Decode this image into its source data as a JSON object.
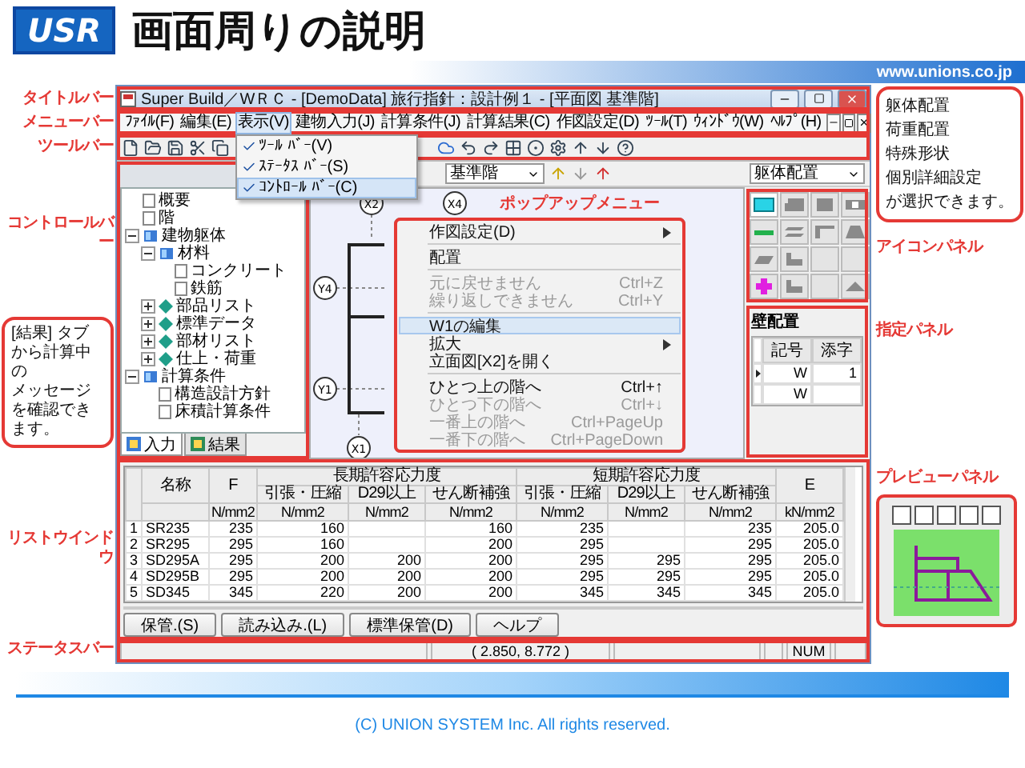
{
  "header": {
    "logo": "USR",
    "title": "画面周りの説明",
    "url": "www.unions.co.jp"
  },
  "left_labels": [
    "タイトルバー",
    "メニューバー",
    "ツールバー",
    "コントロールバー",
    "リストウインドウ",
    "ステータスバー"
  ],
  "left_callout": [
    "[結果] タブから計算中の",
    "メッセージを確認できます。"
  ],
  "window": {
    "title": "Super Build／WＲＣ - [DemoData] 旅行指針：設計例１ - [平面図 基準階]"
  },
  "menus": [
    {
      "label": "ﾌｧｲﾙ(F)",
      "selected": false
    },
    {
      "label": "編集(E)",
      "selected": false
    },
    {
      "label": "表示(V)",
      "selected": true
    },
    {
      "label": "建物入力(J)",
      "selected": false
    },
    {
      "label": "計算条件(J)",
      "selected": false
    },
    {
      "label": "計算結果(C)",
      "selected": false
    },
    {
      "label": "作図設定(D)",
      "selected": false
    },
    {
      "label": "ﾂｰﾙ(T)",
      "selected": false
    },
    {
      "label": "ｳｨﾝﾄﾞｳ(W)",
      "selected": false
    },
    {
      "label": "ﾍﾙﾌﾟ(H)",
      "selected": false
    }
  ],
  "view_menu": [
    {
      "label": "ﾂｰﾙ ﾊﾞｰ(V)",
      "checked": true,
      "selected": false
    },
    {
      "label": "ｽﾃｰﾀｽ ﾊﾞｰ(S)",
      "checked": true,
      "selected": false
    },
    {
      "label": "ｺﾝﾄﾛｰﾙ ﾊﾞｰ(C)",
      "checked": true,
      "selected": true
    }
  ],
  "floor_selector": "基準階",
  "mode_selector": "躯体配置",
  "tree": [
    {
      "label": "概要",
      "kind": "doc"
    },
    {
      "label": "階",
      "kind": "doc"
    },
    {
      "label": "建物躯体",
      "kind": "folder",
      "expanded": true,
      "children": [
        {
          "label": "材料",
          "kind": "folder",
          "expanded": true,
          "children": [
            {
              "label": "コンクリート",
              "kind": "doc"
            },
            {
              "label": "鉄筋",
              "kind": "doc"
            }
          ]
        },
        {
          "label": "部品リスト",
          "kind": "item",
          "expanded": false
        },
        {
          "label": "標準データ",
          "kind": "item",
          "expanded": false
        },
        {
          "label": "部材リスト",
          "kind": "item",
          "expanded": false
        },
        {
          "label": "仕上・荷重",
          "kind": "item",
          "expanded": false
        }
      ]
    },
    {
      "label": "計算条件",
      "kind": "folder",
      "expanded": true,
      "children": [
        {
          "label": "構造設計方針",
          "kind": "doc"
        },
        {
          "label": "床積計算条件",
          "kind": "doc"
        }
      ]
    }
  ],
  "tabs": [
    {
      "label": "入力",
      "selected": true
    },
    {
      "label": "結果",
      "selected": false
    }
  ],
  "grid_labels": [
    "X2",
    "X4",
    "Y4",
    "Y1",
    "X1"
  ],
  "popup_label": "ポップアップメニュー",
  "context_menu": [
    {
      "kind": "item",
      "label": "作図設定(D)",
      "submenu": true,
      "disabled": false,
      "selected": false
    },
    {
      "kind": "separator"
    },
    {
      "kind": "item",
      "label": "配置",
      "submenu": false,
      "disabled": false,
      "selected": false
    },
    {
      "kind": "separator"
    },
    {
      "kind": "item",
      "label": "元に戻せません",
      "shortcut": "Ctrl+Z",
      "submenu": false,
      "disabled": true,
      "selected": false
    },
    {
      "kind": "item",
      "label": "繰り返しできません",
      "shortcut": "Ctrl+Y",
      "submenu": false,
      "disabled": true,
      "selected": false
    },
    {
      "kind": "separator"
    },
    {
      "kind": "item",
      "label": "W1の編集",
      "submenu": false,
      "disabled": false,
      "selected": true
    },
    {
      "kind": "item",
      "label": "拡大",
      "submenu": true,
      "disabled": false,
      "selected": false
    },
    {
      "kind": "item",
      "label": "立面図[X2]を開く",
      "submenu": false,
      "disabled": false,
      "selected": false
    },
    {
      "kind": "separator"
    },
    {
      "kind": "item",
      "label": "ひとつ上の階へ",
      "shortcut": "Ctrl+↑",
      "submenu": false,
      "disabled": false,
      "selected": false
    },
    {
      "kind": "item",
      "label": "ひとつ下の階へ",
      "shortcut": "Ctrl+↓",
      "submenu": false,
      "disabled": true,
      "selected": false
    },
    {
      "kind": "item",
      "label": "一番上の階へ",
      "shortcut": "Ctrl+PageUp",
      "submenu": false,
      "disabled": true,
      "selected": false
    },
    {
      "kind": "item",
      "label": "一番下の階へ",
      "shortcut": "Ctrl+PageDown",
      "submenu": false,
      "disabled": true,
      "selected": false
    }
  ],
  "spec_panel": {
    "title": "壁配置",
    "columns": [
      "記号",
      "添字"
    ],
    "rows": [
      {
        "symbol": "W",
        "index": "1",
        "selected": true
      },
      {
        "symbol": "W",
        "selected": false
      }
    ]
  },
  "list_window": {
    "name_header": "名称",
    "f_header": "F",
    "e_header": "E",
    "groups": [
      {
        "title": "長期許容応力度",
        "columns": [
          "引張・圧縮",
          "D29以上",
          "せん断補強"
        ]
      },
      {
        "title": "短期許容応力度",
        "columns": [
          "引張・圧縮",
          "D29以上",
          "せん断補強"
        ]
      }
    ],
    "units": [
      "N/mm2",
      "N/mm2",
      "N/mm2",
      "N/mm2",
      "N/mm2",
      "N/mm2",
      "N/mm2",
      "kN/mm2"
    ],
    "rows": [
      {
        "no": "1",
        "cells": [
          "SR235",
          "235",
          "160",
          null,
          "160",
          "235",
          null,
          "235",
          "205.0"
        ]
      },
      {
        "no": "2",
        "cells": [
          "SR295",
          "295",
          "160",
          null,
          "200",
          "295",
          null,
          "295",
          "205.0"
        ]
      },
      {
        "no": "3",
        "cells": [
          "SD295A",
          "295",
          "200",
          "200",
          "200",
          "295",
          "295",
          "295",
          "205.0"
        ]
      },
      {
        "no": "4",
        "cells": [
          "SD295B",
          "295",
          "200",
          "200",
          "200",
          "295",
          "295",
          "295",
          "205.0"
        ]
      },
      {
        "no": "5",
        "cells": [
          "SD345",
          "345",
          "220",
          "200",
          "200",
          "345",
          "345",
          "345",
          "205.0"
        ]
      }
    ],
    "buttons": [
      "保管.(S)",
      "読み込み.(L)",
      "標準保管(D)",
      "ヘルプ"
    ]
  },
  "status_bar": {
    "coords": "( 2.850,   8.772 )",
    "num": "NUM"
  },
  "right_callout": [
    "躯体配置",
    "荷重配置",
    "特殊形状",
    "個別詳細設定",
    "が選択できます。"
  ],
  "right_labels": [
    "アイコンパネル",
    "指定パネル",
    "プレビューパネル"
  ],
  "footer": "(C)  UNION SYSTEM Inc. All rights reserved."
}
